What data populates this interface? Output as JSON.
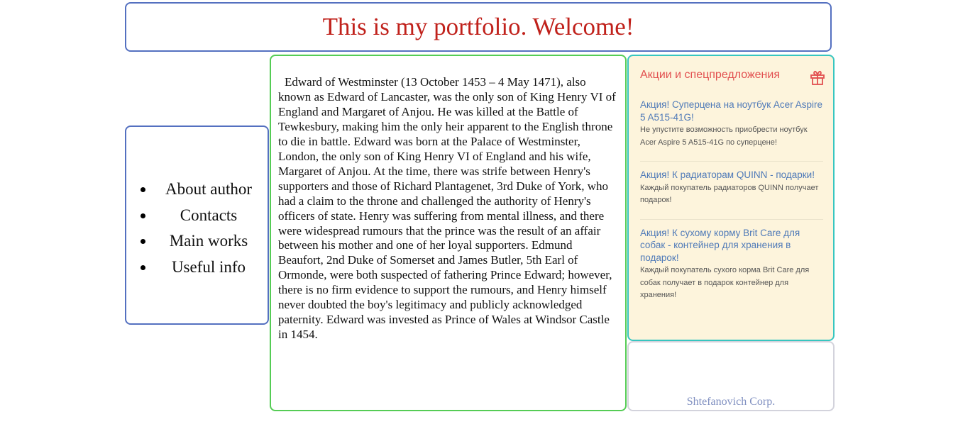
{
  "header": {
    "title": "This is my portfolio. Welcome!"
  },
  "nav": {
    "items": [
      {
        "label": "About author"
      },
      {
        "label": "Contacts"
      },
      {
        "label": "Main works"
      },
      {
        "label": "Useful info"
      }
    ]
  },
  "content": {
    "text": "Edward of Westminster (13 October 1453 – 4 May 1471), also known as Edward of Lancaster, was the only son of King Henry VI of England and Margaret of Anjou. He was killed at the Battle of Tewkesbury, making him the only heir apparent to the English throne to die in battle. Edward was born at the Palace of Westminster, London, the only son of King Henry VI of England and his wife, Margaret of Anjou. At the time, there was strife between Henry's supporters and those of Richard Plantagenet, 3rd Duke of York, who had a claim to the throne and challenged the authority of Henry's officers of state. Henry was suffering from mental illness, and there were widespread rumours that the prince was the result of an affair between his mother and one of her loyal supporters. Edmund Beaufort, 2nd Duke of Somerset and James Butler, 5th Earl of Ormonde, were both suspected of fathering Prince Edward; however, there is no firm evidence to support the rumours, and Henry himself never doubted the boy's legitimacy and publicly acknowledged paternity. Edward was invested as Prince of Wales at Windsor Castle in 1454."
  },
  "promo": {
    "title": "Акции и спецпредложения",
    "icon": "gift-icon",
    "offers": [
      {
        "title": "Акция! Суперцена на ноутбук Acer Aspire 5 A515-41G!",
        "desc": "Не упустите возможность приобрести ноутбук Acer Aspire 5 A515-41G по суперцене!"
      },
      {
        "title": "Акция! К радиаторам QUINN - подарки!",
        "desc": "Каждый покупатель радиаторов QUINN получает подарок!"
      },
      {
        "title": "Акция! К сухому корму Brit Care для собак - контейнер для хранения в подарок!",
        "desc": "Каждый покупатель сухого корма Brit Care для собак получает в подарок контейнер для хранения!"
      }
    ]
  },
  "footer": {
    "text": "Shtefanovich Corp."
  },
  "colors": {
    "header_border": "#5470c0",
    "title": "#c0211b",
    "content_border": "#55cc55",
    "promo_border": "#37c6c0",
    "promo_bg": "#fdf4dc",
    "promo_title": "#e25050",
    "offer_link": "#4f7ab8",
    "footer_text": "#7f8fc0"
  }
}
